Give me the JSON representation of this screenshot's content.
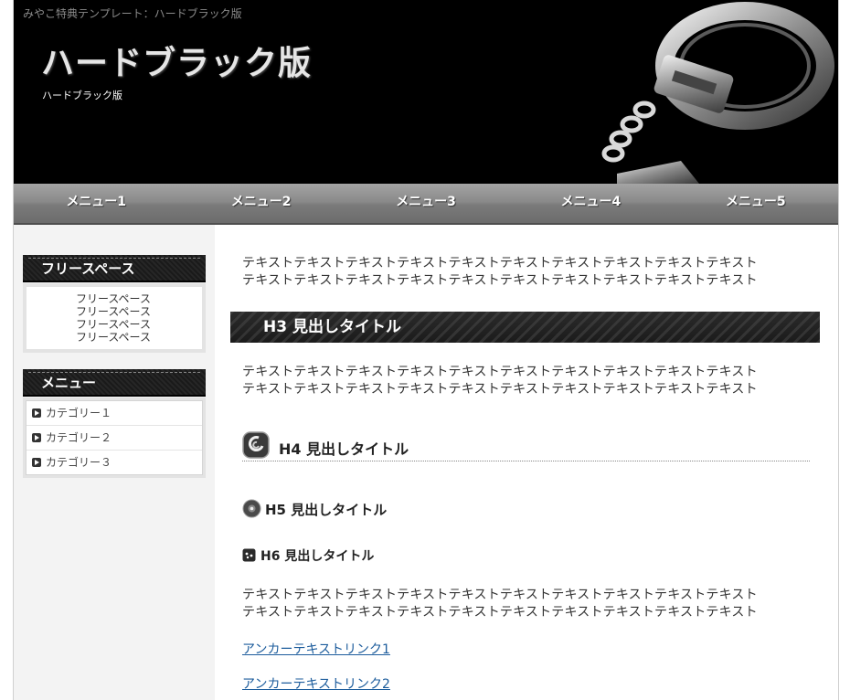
{
  "header": {
    "tagline": "みやこ特典テンプレート：ハードブラック版",
    "title": "ハードブラック版",
    "subtitle": "ハードブラック版"
  },
  "nav": {
    "items": [
      "メニュー1",
      "メニュー2",
      "メニュー3",
      "メニュー4",
      "メニュー5"
    ]
  },
  "sidebar": {
    "free_title": "フリースペース",
    "free_lines": [
      "フリースペース",
      "フリースペース",
      "フリースペース",
      "フリースペース"
    ],
    "menu_title": "メニュー",
    "menu_items": [
      "カテゴリー１",
      "カテゴリー２",
      "カテゴリー３"
    ]
  },
  "main": {
    "para1": [
      "テキストテキストテキストテキストテキストテキストテキストテキストテキストテキスト",
      "テキストテキストテキストテキストテキストテキストテキストテキストテキストテキスト"
    ],
    "h3": "H3 見出しタイトル",
    "para2": [
      "テキストテキストテキストテキストテキストテキストテキストテキストテキストテキスト",
      "テキストテキストテキストテキストテキストテキストテキストテキストテキストテキスト"
    ],
    "h4": "H4 見出しタイトル",
    "h5": "H5 見出しタイトル",
    "h6": "H6 見出しタイトル",
    "para3": [
      "テキストテキストテキストテキストテキストテキストテキストテキストテキストテキスト",
      "テキストテキストテキストテキストテキストテキストテキストテキストテキストテキスト"
    ],
    "links": [
      "アンカーテキストリンク1",
      "アンカーテキストリンク2"
    ]
  },
  "colors": {
    "header_bg": "#000000",
    "nav_bg": "#8a8a8a",
    "link": "#1c5c9c",
    "sidebar_bg": "#f3f3f3"
  }
}
